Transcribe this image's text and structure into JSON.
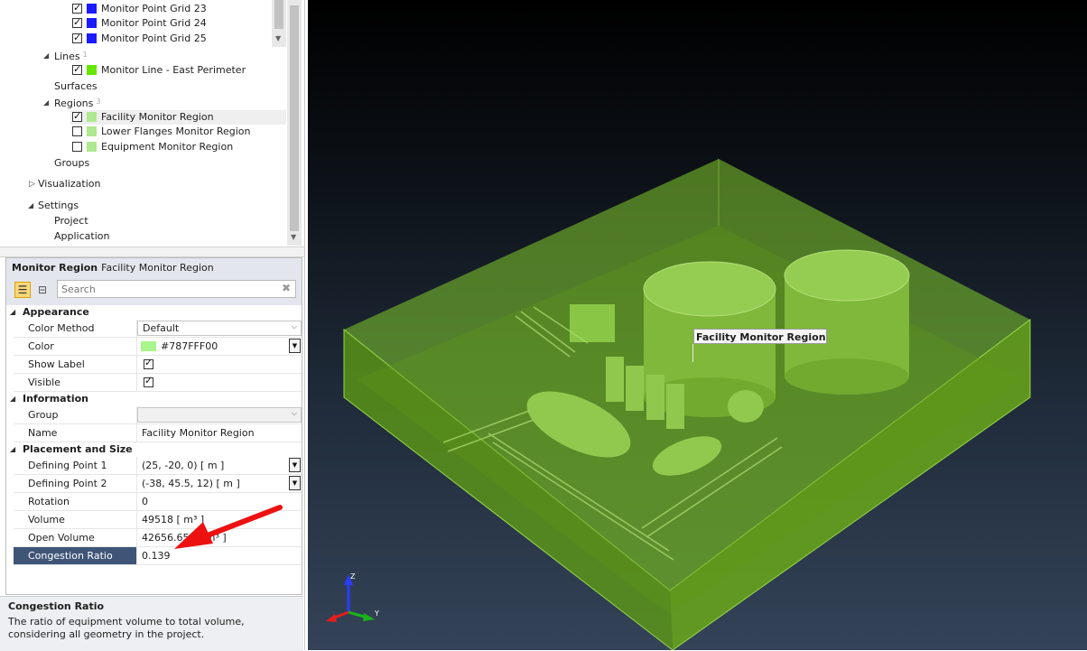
{
  "tree": {
    "point_items": [
      {
        "label": "Monitor Point Grid 23",
        "checked": true,
        "color": "#1a1aff"
      },
      {
        "label": "Monitor Point Grid 24",
        "checked": true,
        "color": "#1a1aff"
      },
      {
        "label": "Monitor Point Grid 25",
        "checked": true,
        "color": "#1a1aff"
      }
    ],
    "lines_label": "Lines",
    "lines_count": "1",
    "line_item": {
      "label": "Monitor Line - East Perimeter",
      "checked": true,
      "color": "#66e600"
    },
    "surfaces_label": "Surfaces",
    "regions_label": "Regions",
    "regions_count": "3",
    "region_items": [
      {
        "label": "Facility Monitor Region",
        "checked": true,
        "color": "#aee88f"
      },
      {
        "label": "Lower Flanges Monitor Region",
        "checked": false,
        "color": "#aee88f"
      },
      {
        "label": "Equipment Monitor Region",
        "checked": false,
        "color": "#aee88f"
      }
    ],
    "groups_label": "Groups",
    "visualization_label": "Visualization",
    "settings_label": "Settings",
    "project_label": "Project",
    "application_label": "Application"
  },
  "properties": {
    "type_label": "Monitor Region",
    "object_name": "Facility Monitor Region",
    "search_placeholder": "Search",
    "appearance": {
      "title": "Appearance",
      "color_method_label": "Color Method",
      "color_method_value": "Default",
      "color_label": "Color",
      "color_value": "#787FFF00",
      "color_swatch": "#aaf58c",
      "show_label_label": "Show Label",
      "visible_label": "Visible"
    },
    "information": {
      "title": "Information",
      "group_label": "Group",
      "group_value": "",
      "name_label": "Name",
      "name_value": "Facility Monitor Region"
    },
    "placement": {
      "title": "Placement and Size",
      "p1_label": "Defining Point 1",
      "p1_value": "(25, -20, 0) [ m ]",
      "p2_label": "Defining Point 2",
      "p2_value": "(-38, 45.5, 12) [ m ]",
      "rotation_label": "Rotation",
      "rotation_value": "0",
      "volume_label": "Volume",
      "volume_value": "49518 [ m³ ]",
      "open_volume_label": "Open Volume",
      "open_volume_value": "42656.656 [ m³ ]",
      "congestion_label": "Congestion Ratio",
      "congestion_value": "0.139"
    }
  },
  "description": {
    "title": "Congestion Ratio",
    "text": "The ratio of equipment volume to total volume, considering all geometry in the project."
  },
  "viewport": {
    "region_label": "Facility Monitor Region",
    "axis_z": "Z",
    "axis_y": "Y",
    "region_color": "#6ab016"
  }
}
